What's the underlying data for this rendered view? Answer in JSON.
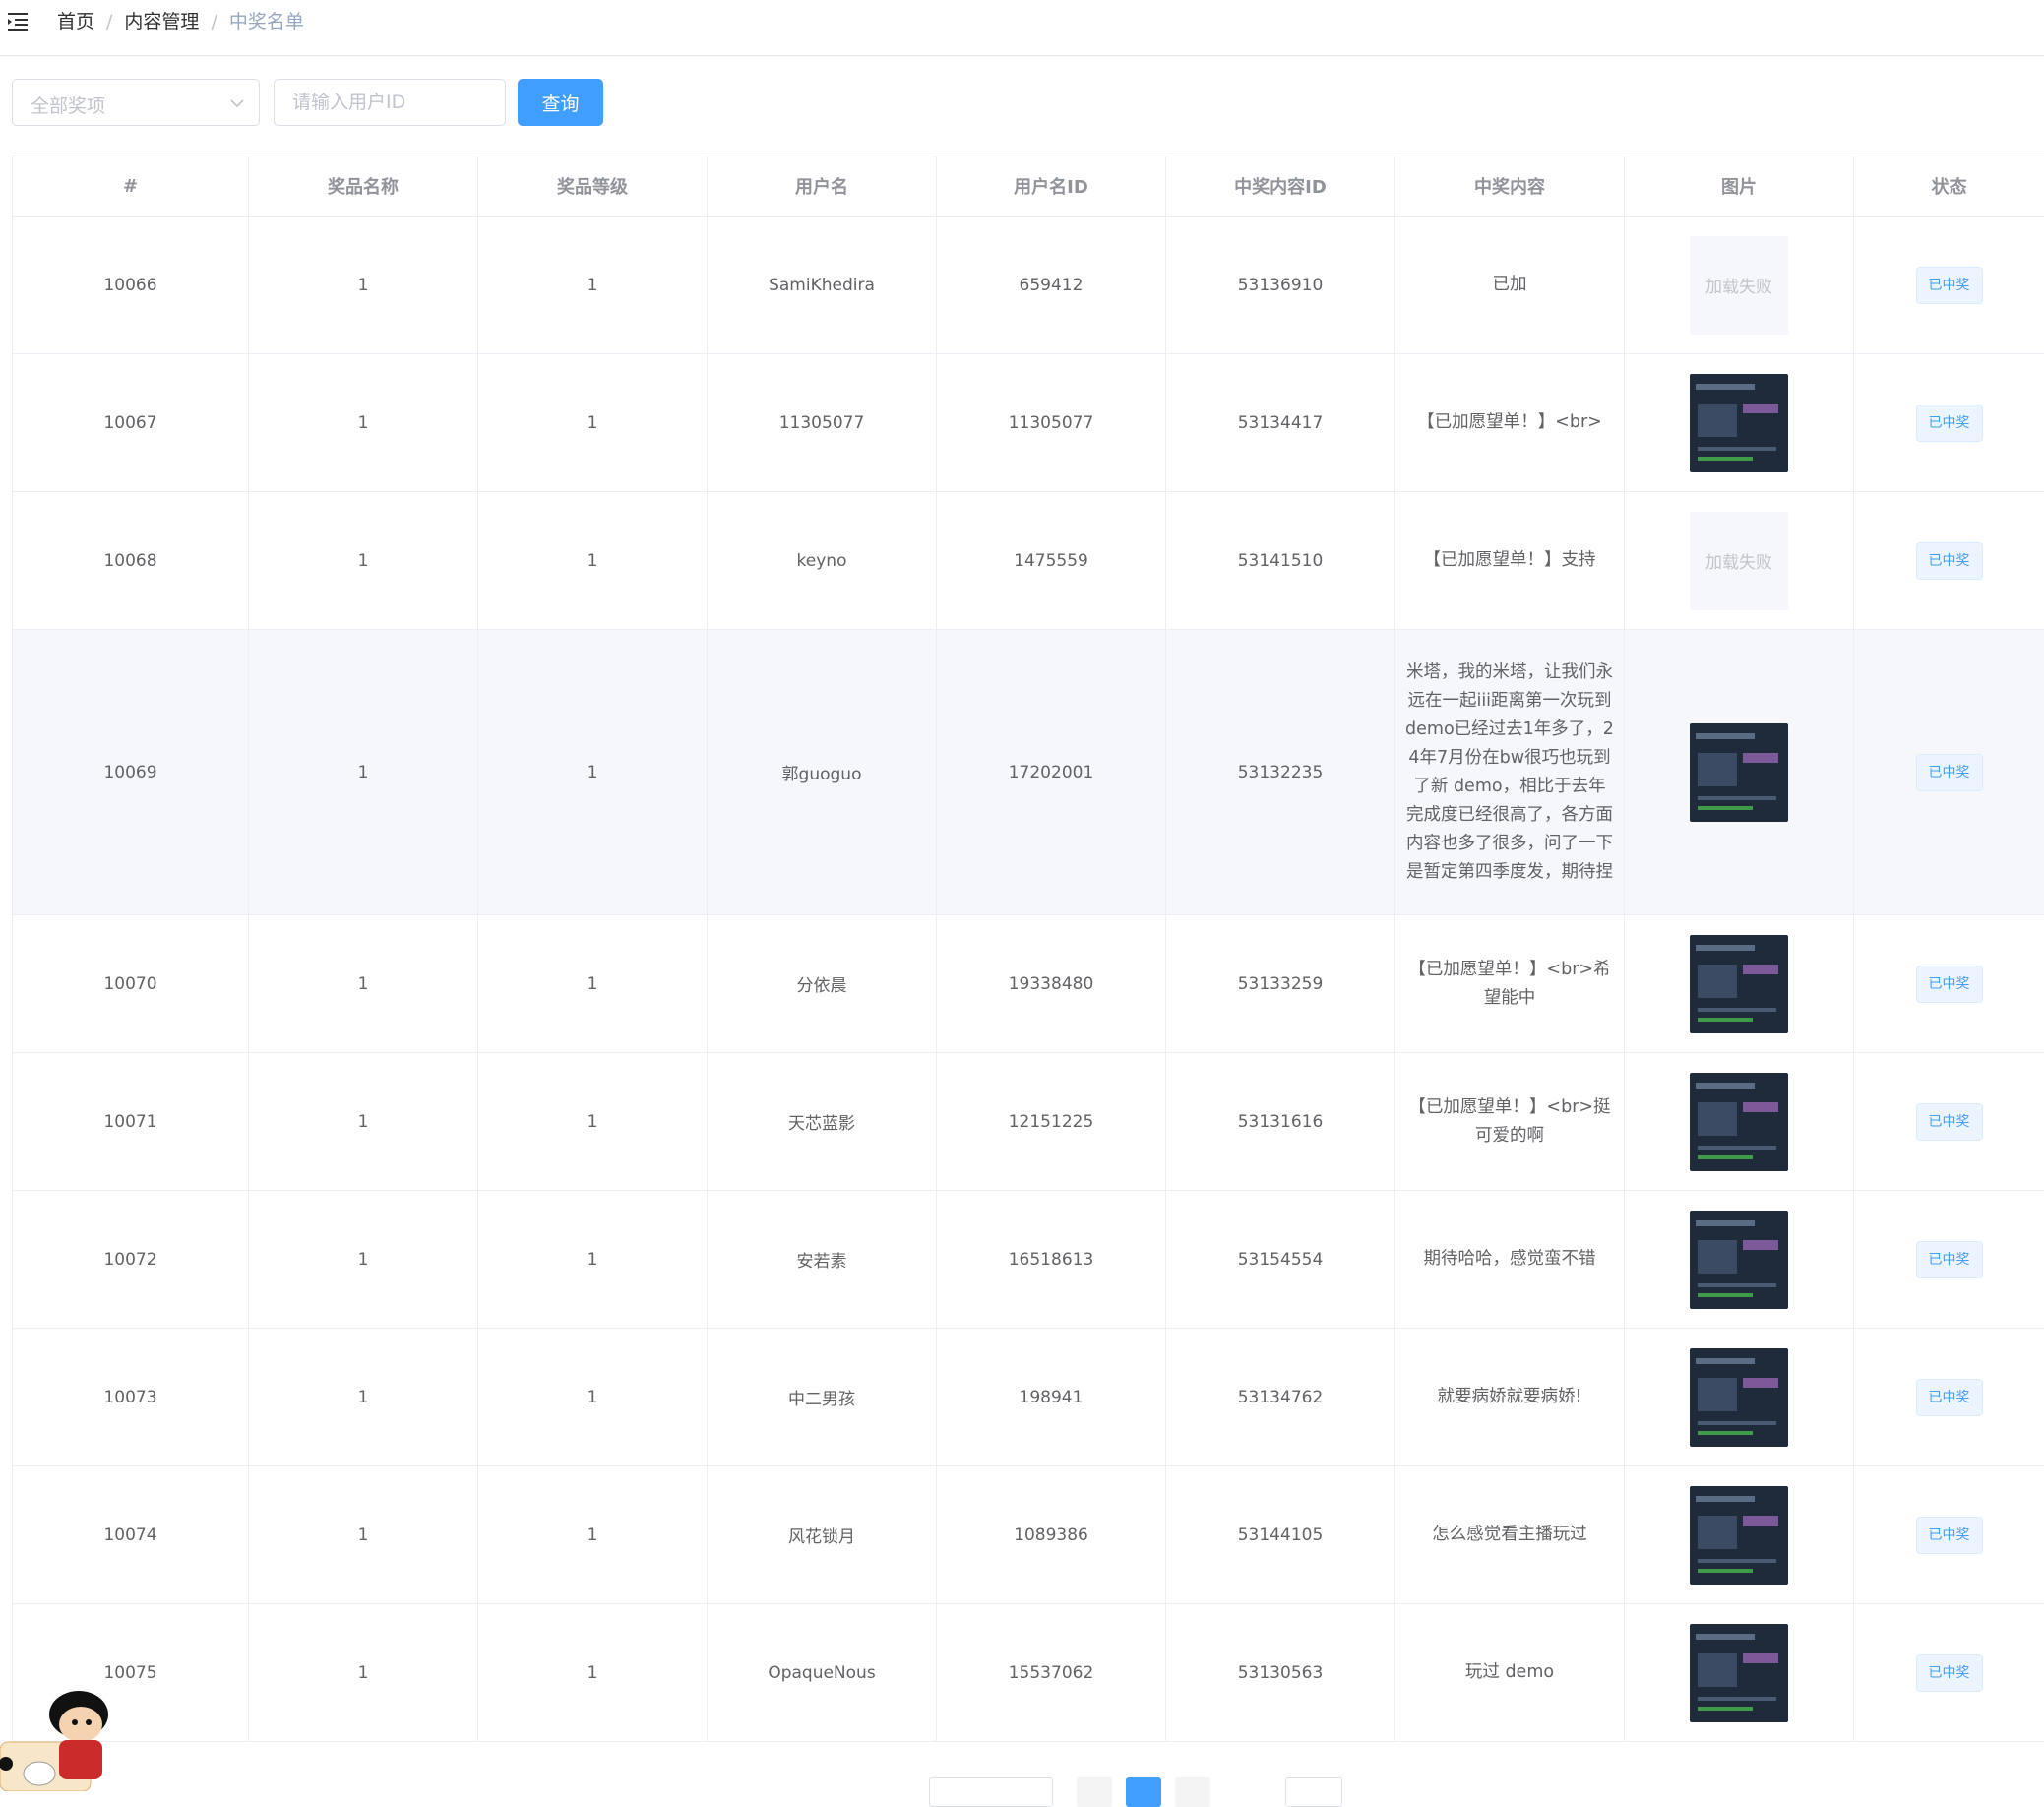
{
  "breadcrumb": {
    "home": "首页",
    "section": "内容管理",
    "current": "中奖名单",
    "separator": "/"
  },
  "filter": {
    "select_placeholder": "全部奖项",
    "input_placeholder": "请输入用户ID",
    "query_label": "查询"
  },
  "icons": {
    "menu": "menu-fold-icon",
    "dropdown": "chevron-down-icon",
    "mascot": "cartoon-mascot"
  },
  "colors": {
    "primary": "#409eff",
    "tag_bg": "#ecf5ff",
    "header_text": "#909399"
  },
  "table": {
    "headers": [
      "#",
      "奖品名称",
      "奖品等级",
      "用户名",
      "用户名ID",
      "中奖内容ID",
      "中奖内容",
      "图片",
      "状态"
    ],
    "image_fail_text": "加载失败",
    "rows": [
      {
        "id": "10066",
        "prize_name": "1",
        "prize_level": "1",
        "username": "SamiKhedira",
        "user_id": "659412",
        "content_id": "53136910",
        "content": "已加",
        "image": "failed",
        "status": "已中奖"
      },
      {
        "id": "10067",
        "prize_name": "1",
        "prize_level": "1",
        "username": "11305077",
        "user_id": "11305077",
        "content_id": "53134417",
        "content": "【已加愿望单！】<br>",
        "image": "screenshot",
        "status": "已中奖"
      },
      {
        "id": "10068",
        "prize_name": "1",
        "prize_level": "1",
        "username": "keyno",
        "user_id": "1475559",
        "content_id": "53141510",
        "content": "【已加愿望单！】支持",
        "image": "failed",
        "status": "已中奖"
      },
      {
        "id": "10069",
        "prize_name": "1",
        "prize_level": "1",
        "username": "郭guoguo",
        "user_id": "17202001",
        "content_id": "53132235",
        "content": "米塔，我的米塔，让我们永远在一起iii距离第一次玩到demo已经过去1年多了，24年7月份在bw很巧也玩到了新 demo，相比于去年完成度已经很高了，各方面内容也多了很多，问了一下是暂定第四季度发，期待捏",
        "image": "screenshot",
        "status": "已中奖"
      },
      {
        "id": "10070",
        "prize_name": "1",
        "prize_level": "1",
        "username": "分依晨",
        "user_id": "19338480",
        "content_id": "53133259",
        "content": "【已加愿望单！】<br>希望能中",
        "image": "screenshot",
        "status": "已中奖"
      },
      {
        "id": "10071",
        "prize_name": "1",
        "prize_level": "1",
        "username": "天芯蓝影",
        "user_id": "12151225",
        "content_id": "53131616",
        "content": "【已加愿望单！】<br>挺可爱的啊",
        "image": "screenshot",
        "status": "已中奖"
      },
      {
        "id": "10072",
        "prize_name": "1",
        "prize_level": "1",
        "username": "安若素",
        "user_id": "16518613",
        "content_id": "53154554",
        "content": "期待哈哈，感觉蛮不错",
        "image": "screenshot",
        "status": "已中奖"
      },
      {
        "id": "10073",
        "prize_name": "1",
        "prize_level": "1",
        "username": "中二男孩",
        "user_id": "198941",
        "content_id": "53134762",
        "content": "就要病娇就要病娇!",
        "image": "screenshot",
        "status": "已中奖"
      },
      {
        "id": "10074",
        "prize_name": "1",
        "prize_level": "1",
        "username": "风花锁月",
        "user_id": "1089386",
        "content_id": "53144105",
        "content": "怎么感觉看主播玩过",
        "image": "screenshot",
        "status": "已中奖"
      },
      {
        "id": "10075",
        "prize_name": "1",
        "prize_level": "1",
        "username": "OpaqueNous",
        "user_id": "15537062",
        "content_id": "53130563",
        "content": "玩过 demo",
        "image": "screenshot",
        "status": "已中奖"
      }
    ]
  }
}
